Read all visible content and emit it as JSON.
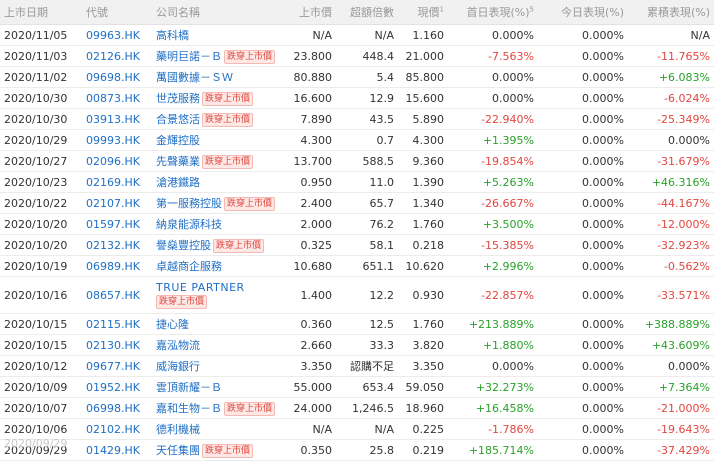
{
  "headers": {
    "date": "上市日期",
    "code": "代號",
    "name": "公司名稱",
    "price": "上市價",
    "over": "超額倍數",
    "cur": "現價",
    "cur_sup": "1",
    "first": "首日表現(%)",
    "first_sup": "5",
    "today": "今日表現(%)",
    "cum": "累積表現(%)"
  },
  "tag_label": "跌穿上市價",
  "watermark": "2020/09/29",
  "colors": {
    "positive": "#2aa12a",
    "negative": "#e0473f",
    "link": "#1f6fc6",
    "tag": "#e0473f"
  },
  "rows": [
    {
      "date": "2020/11/05",
      "code": "09963.HK",
      "name": "高科橋",
      "tag": false,
      "price": "N/A",
      "over": "N/A",
      "cur": "1.160",
      "first": "0.000%",
      "first_s": "zero",
      "today": "0.000%",
      "cum": "N/A",
      "cum_s": "zero"
    },
    {
      "date": "2020/11/03",
      "code": "02126.HK",
      "name": "藥明巨諾－Ｂ",
      "tag": true,
      "price": "23.800",
      "over": "448.4",
      "cur": "21.000",
      "first": "-7.563%",
      "first_s": "neg",
      "today": "0.000%",
      "cum": "-11.765%",
      "cum_s": "neg"
    },
    {
      "date": "2020/11/02",
      "code": "09698.HK",
      "name": "萬國數據－ＳＷ",
      "tag": false,
      "price": "80.880",
      "over": "5.4",
      "cur": "85.800",
      "first": "0.000%",
      "first_s": "zero",
      "today": "0.000%",
      "cum": "+6.083%",
      "cum_s": "pos"
    },
    {
      "date": "2020/10/30",
      "code": "00873.HK",
      "name": "世茂服務",
      "tag": true,
      "price": "16.600",
      "over": "12.9",
      "cur": "15.600",
      "first": "0.000%",
      "first_s": "zero",
      "today": "0.000%",
      "cum": "-6.024%",
      "cum_s": "neg"
    },
    {
      "date": "2020/10/30",
      "code": "03913.HK",
      "name": "合景悠活",
      "tag": true,
      "price": "7.890",
      "over": "43.5",
      "cur": "5.890",
      "first": "-22.940%",
      "first_s": "neg",
      "today": "0.000%",
      "cum": "-25.349%",
      "cum_s": "neg"
    },
    {
      "date": "2020/10/29",
      "code": "09993.HK",
      "name": "金輝控股",
      "tag": false,
      "price": "4.300",
      "over": "0.7",
      "cur": "4.300",
      "first": "+1.395%",
      "first_s": "pos",
      "today": "0.000%",
      "cum": "0.000%",
      "cum_s": "zero"
    },
    {
      "date": "2020/10/27",
      "code": "02096.HK",
      "name": "先聲藥業",
      "tag": true,
      "price": "13.700",
      "over": "588.5",
      "cur": "9.360",
      "first": "-19.854%",
      "first_s": "neg",
      "today": "0.000%",
      "cum": "-31.679%",
      "cum_s": "neg"
    },
    {
      "date": "2020/10/23",
      "code": "02169.HK",
      "name": "滄港鐵路",
      "tag": false,
      "price": "0.950",
      "over": "11.0",
      "cur": "1.390",
      "first": "+5.263%",
      "first_s": "pos",
      "today": "0.000%",
      "cum": "+46.316%",
      "cum_s": "pos"
    },
    {
      "date": "2020/10/22",
      "code": "02107.HK",
      "name": "第一服務控股",
      "tag": true,
      "price": "2.400",
      "over": "65.7",
      "cur": "1.340",
      "first": "-26.667%",
      "first_s": "neg",
      "today": "0.000%",
      "cum": "-44.167%",
      "cum_s": "neg"
    },
    {
      "date": "2020/10/20",
      "code": "01597.HK",
      "name": "納泉能源科技",
      "tag": false,
      "price": "2.000",
      "over": "76.2",
      "cur": "1.760",
      "first": "+3.500%",
      "first_s": "pos",
      "today": "0.000%",
      "cum": "-12.000%",
      "cum_s": "neg"
    },
    {
      "date": "2020/10/20",
      "code": "02132.HK",
      "name": "譽燊豐控股",
      "tag": true,
      "price": "0.325",
      "over": "58.1",
      "cur": "0.218",
      "first": "-15.385%",
      "first_s": "neg",
      "today": "0.000%",
      "cum": "-32.923%",
      "cum_s": "neg"
    },
    {
      "date": "2020/10/19",
      "code": "06989.HK",
      "name": "卓越商企服務",
      "tag": false,
      "price": "10.680",
      "over": "651.1",
      "cur": "10.620",
      "first": "+2.996%",
      "first_s": "pos",
      "today": "0.000%",
      "cum": "-0.562%",
      "cum_s": "neg"
    },
    {
      "date": "2020/10/16",
      "code": "08657.HK",
      "name": "TRUE PARTNER",
      "tag": true,
      "tall": true,
      "price": "1.400",
      "over": "12.2",
      "cur": "0.930",
      "first": "-22.857%",
      "first_s": "neg",
      "today": "0.000%",
      "cum": "-33.571%",
      "cum_s": "neg"
    },
    {
      "date": "2020/10/15",
      "code": "02115.HK",
      "name": "捷心隆",
      "tag": false,
      "price": "0.360",
      "over": "12.5",
      "cur": "1.760",
      "first": "+213.889%",
      "first_s": "pos",
      "today": "0.000%",
      "cum": "+388.889%",
      "cum_s": "pos"
    },
    {
      "date": "2020/10/15",
      "code": "02130.HK",
      "name": "嘉泓物流",
      "tag": false,
      "price": "2.660",
      "over": "33.3",
      "cur": "3.820",
      "first": "+1.880%",
      "first_s": "pos",
      "today": "0.000%",
      "cum": "+43.609%",
      "cum_s": "pos"
    },
    {
      "date": "2020/10/12",
      "code": "09677.HK",
      "name": "威海銀行",
      "tag": false,
      "price": "3.350",
      "over": "認購不足",
      "cur": "3.350",
      "first": "0.000%",
      "first_s": "zero",
      "today": "0.000%",
      "cum": "0.000%",
      "cum_s": "zero"
    },
    {
      "date": "2020/10/09",
      "code": "01952.HK",
      "name": "雲頂新耀－Ｂ",
      "tag": false,
      "price": "55.000",
      "over": "653.4",
      "cur": "59.050",
      "first": "+32.273%",
      "first_s": "pos",
      "today": "0.000%",
      "cum": "+7.364%",
      "cum_s": "pos"
    },
    {
      "date": "2020/10/07",
      "code": "06998.HK",
      "name": "嘉和生物－Ｂ",
      "tag": true,
      "price": "24.000",
      "over": "1,246.5",
      "cur": "18.960",
      "first": "+16.458%",
      "first_s": "pos",
      "today": "0.000%",
      "cum": "-21.000%",
      "cum_s": "neg"
    },
    {
      "date": "2020/10/06",
      "code": "02102.HK",
      "name": "德利機械",
      "tag": false,
      "price": "N/A",
      "over": "N/A",
      "cur": "0.225",
      "first": "-1.786%",
      "first_s": "neg",
      "today": "0.000%",
      "cum": "-19.643%",
      "cum_s": "neg"
    },
    {
      "date": "2020/09/29",
      "code": "01429.HK",
      "name": "天任集團",
      "tag": true,
      "price": "0.350",
      "over": "25.8",
      "cur": "0.219",
      "first": "+185.714%",
      "first_s": "pos",
      "today": "0.000%",
      "cum": "-37.429%",
      "cum_s": "neg"
    }
  ]
}
